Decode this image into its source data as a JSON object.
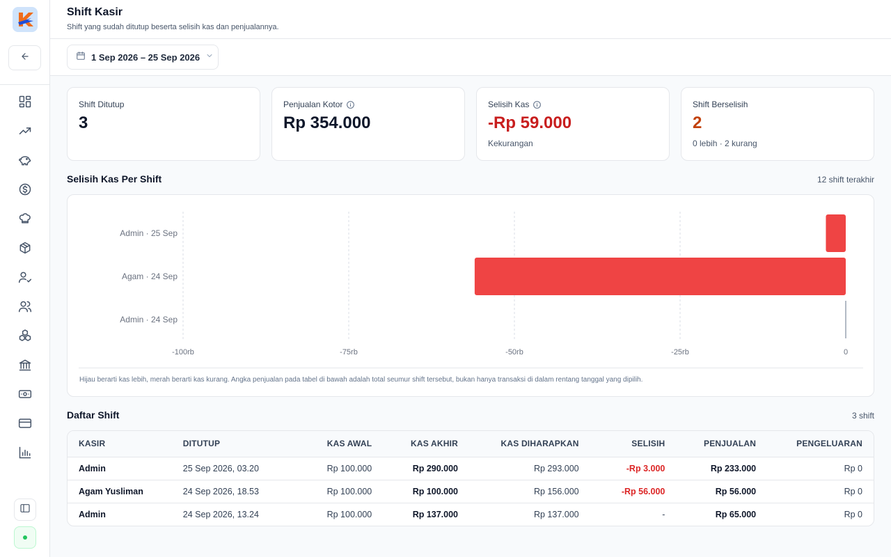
{
  "app": {
    "title": "Shift Kasir",
    "subtitle": "Shift yang sudah ditutup beserta selisih kas dan penjualannya."
  },
  "toolbar": {
    "date_range": "1 Sep 2026 – 25 Sep 2026"
  },
  "colors": {
    "accent_negative": "#ef4444",
    "text_negative": "#c81e1e",
    "warning": "#c2410c",
    "status_ok": "#22c55e"
  },
  "sidebar": {
    "icons": [
      "dashboard-icon",
      "trending-up-icon",
      "piggy-bank-icon",
      "dollar-circle-icon",
      "chef-hat-icon",
      "box-icon",
      "user-check-icon",
      "users-icon",
      "boxes-icon",
      "bank-icon",
      "banknote-icon",
      "credit-card-icon",
      "bar-chart-icon"
    ]
  },
  "stats": [
    {
      "label": "Shift Ditutup",
      "value": "3",
      "note": ""
    },
    {
      "label": "Penjualan Kotor",
      "value": "Rp 354.000",
      "note": ""
    },
    {
      "label": "Selisih Kas",
      "value": "-Rp 59.000",
      "note": "Kekurangan"
    },
    {
      "label": "Shift Berselisih",
      "value": "2",
      "note": "0 lebih · 2 kurang"
    }
  ],
  "chart_section": {
    "title": "Selisih Kas Per Shift",
    "meta": "12 shift terakhir",
    "note": "Hijau berarti kas lebih, merah berarti kas kurang. Angka penjualan pada tabel di bawah adalah total seumur shift tersebut, bukan hanya transaksi di dalam rentang tanggal yang dipilih."
  },
  "chart_data": {
    "type": "bar",
    "orientation": "horizontal",
    "categories": [
      "Admin · 25 Sep",
      "Agam · 24 Sep",
      "Admin · 24 Sep"
    ],
    "values": [
      -3000,
      -56000,
      0
    ],
    "xlim": [
      -100000,
      0
    ],
    "xticks": [
      -100000,
      -75000,
      -50000,
      -25000,
      0
    ],
    "xtick_labels": [
      "-100rb",
      "-75rb",
      "-50rb",
      "-25rb",
      "0"
    ],
    "grid": true,
    "bar_color": "#ef4444"
  },
  "table_section": {
    "title": "Daftar Shift",
    "meta": "3 shift"
  },
  "table": {
    "headers": [
      "KASIR",
      "DITUTUP",
      "KAS AWAL",
      "KAS AKHIR",
      "KAS DIHARAPKAN",
      "SELISIH",
      "PENJUALAN",
      "PENGELUARAN"
    ],
    "rows": [
      [
        "Admin",
        "25 Sep 2026, 03.20",
        "Rp 100.000",
        "Rp 290.000",
        "Rp 293.000",
        "-Rp 3.000",
        "Rp 233.000",
        "Rp 0"
      ],
      [
        "Agam Yusliman",
        "24 Sep 2026, 18.53",
        "Rp 100.000",
        "Rp 100.000",
        "Rp 156.000",
        "-Rp 56.000",
        "Rp 56.000",
        "Rp 0"
      ],
      [
        "Admin",
        "24 Sep 2026, 13.24",
        "Rp 100.000",
        "Rp 137.000",
        "Rp 137.000",
        "-",
        "Rp 65.000",
        "Rp 0"
      ]
    ]
  }
}
